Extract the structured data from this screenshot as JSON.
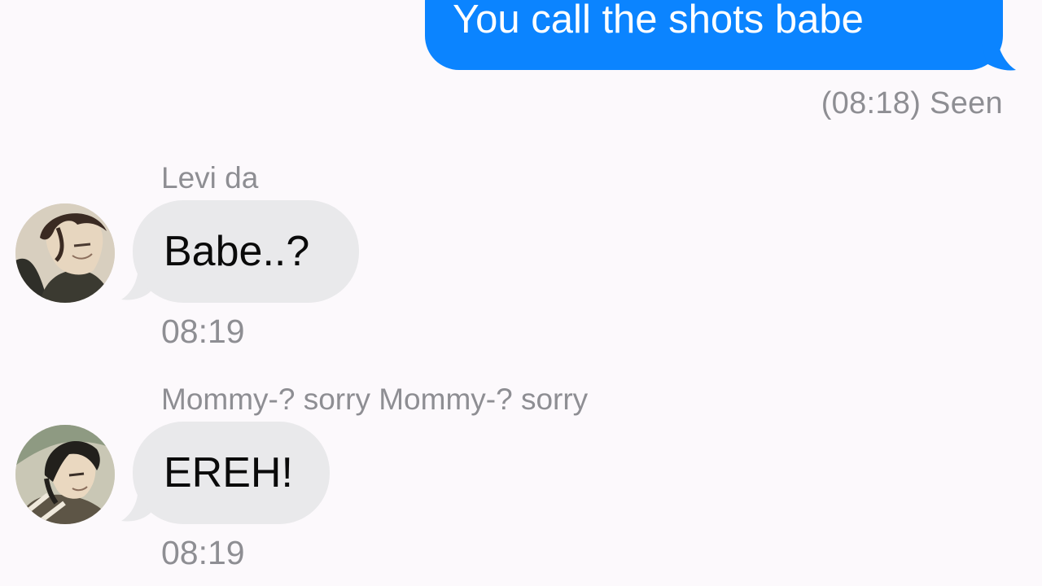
{
  "colors": {
    "background": "#fcf9fc",
    "outgoing_bubble": "#0b84ff",
    "incoming_bubble": "#e9e9eb",
    "meta_text": "#8e8e93"
  },
  "outgoing": {
    "text": "You call the shots babe",
    "status": "(08:18) Seen"
  },
  "incoming": [
    {
      "sender": "Levi da",
      "text": "Babe..?",
      "time": "08:19",
      "avatar_icon": "anime-character-avatar"
    },
    {
      "sender": "Mommy-? sorry Mommy-? sorry",
      "text": "EREH!",
      "time": "08:19",
      "avatar_icon": "anime-character-avatar"
    }
  ]
}
